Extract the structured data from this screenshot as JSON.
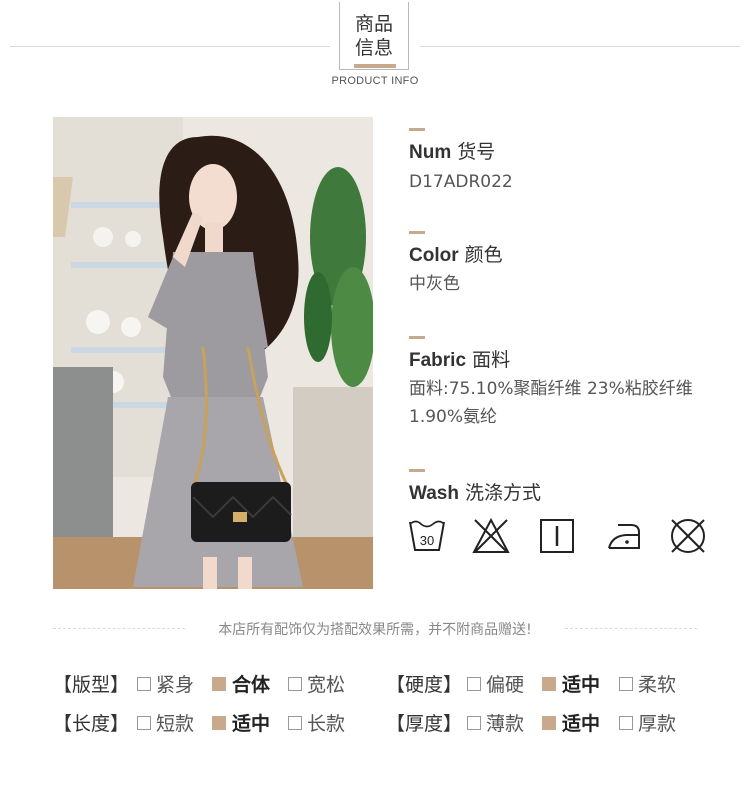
{
  "header": {
    "title_line1": "商品",
    "title_line2": "信息",
    "subtitle": "PRODUCT INFO"
  },
  "details": {
    "num": {
      "label_en": "Num",
      "label_cn": "货号",
      "value": "D17ADR022"
    },
    "color": {
      "label_en": "Color",
      "label_cn": "颜色",
      "value": "中灰色"
    },
    "fabric": {
      "label_en": "Fabric",
      "label_cn": "面料",
      "value_line1": "面料:75.10%聚酯纤维 23%粘胶纤维",
      "value_line2": "1.90%氨纶"
    },
    "wash": {
      "label_en": "Wash",
      "label_cn": "洗涤方式"
    }
  },
  "wash_icons": [
    "wash-30-icon",
    "do-not-bleach-icon",
    "tumble-dry-icon",
    "iron-low-icon",
    "do-not-dry-clean-icon"
  ],
  "wash_icon_text": {
    "temperature": "30"
  },
  "note": "本店所有配饰仅为搭配效果所需，并不附商品赠送!",
  "specs": {
    "fit": {
      "label": "【版型】",
      "options": [
        "紧身",
        "合体",
        "宽松"
      ],
      "selected": 1
    },
    "length": {
      "label": "【长度】",
      "options": [
        "短款",
        "适中",
        "长款"
      ],
      "selected": 1
    },
    "hardness": {
      "label": "【硬度】",
      "options": [
        "偏硬",
        "适中",
        "柔软"
      ],
      "selected": 1
    },
    "thickness": {
      "label": "【厚度】",
      "options": [
        "薄款",
        "适中",
        "厚款"
      ],
      "selected": 1
    }
  },
  "colors": {
    "accent": "#c8a98b",
    "text": "#333333",
    "muted": "#888888"
  }
}
